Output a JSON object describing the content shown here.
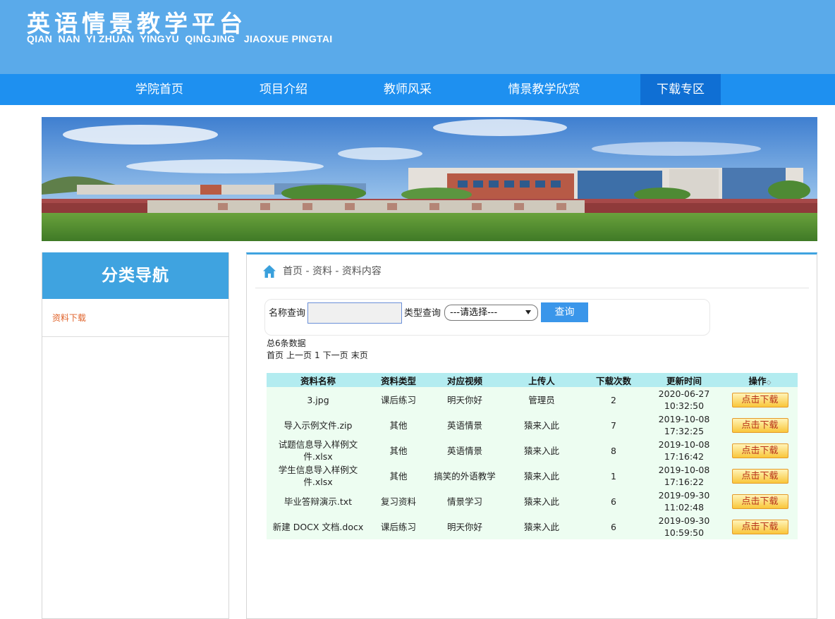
{
  "header": {
    "title": "英语情景教学平台",
    "subtitle": "QIAN  NAN  YI ZHUAN  YINGYU  QINGJING   JIAOXUE PINGTAI"
  },
  "nav": {
    "items": [
      {
        "label": "学院首页"
      },
      {
        "label": "项目介绍"
      },
      {
        "label": "教师风采"
      },
      {
        "label": "情景教学欣赏"
      },
      {
        "label": "下载专区"
      }
    ],
    "active_index": 4
  },
  "sidebar": {
    "heading": "分类导航",
    "links": [
      {
        "label": "资料下载"
      }
    ]
  },
  "breadcrumb": {
    "text": "首页 - 资料 - 资料内容"
  },
  "search": {
    "name_label": "名称查询",
    "name_value": "",
    "type_label": "类型查询",
    "type_selected": "---请选择---",
    "button_label": "查询"
  },
  "summary": {
    "total_text": "总6条数据",
    "pager": {
      "first": "首页",
      "prev": "上一页",
      "page": "1",
      "next": "下一页",
      "last": "末页"
    }
  },
  "table": {
    "columns": [
      "资料名称",
      "资料类型",
      "对应视频",
      "上传人",
      "下载次数",
      "更新时间",
      "操作"
    ],
    "rows": [
      {
        "name": "3.jpg",
        "type": "课后练习",
        "video": "明天你好",
        "uploader": "管理员",
        "downloads": "2",
        "date": "2020-06-27",
        "time": "10:32:50",
        "action": "点击下载"
      },
      {
        "name": "导入示例文件.zip",
        "type": "其他",
        "video": "英语情景",
        "uploader": "猿来入此",
        "downloads": "7",
        "date": "2019-10-08",
        "time": "17:32:25",
        "action": "点击下载"
      },
      {
        "name": "试题信息导入样例文件.xlsx",
        "type": "其他",
        "video": "英语情景",
        "uploader": "猿来入此",
        "downloads": "8",
        "date": "2019-10-08",
        "time": "17:16:42",
        "action": "点击下载"
      },
      {
        "name": "学生信息导入样例文件.xlsx",
        "type": "其他",
        "video": "搞笑的外语教学",
        "uploader": "猿来入此",
        "downloads": "1",
        "date": "2019-10-08",
        "time": "17:16:22",
        "action": "点击下载"
      },
      {
        "name": "毕业答辩演示.txt",
        "type": "复习资料",
        "video": "情景学习",
        "uploader": "猿来入此",
        "downloads": "6",
        "date": "2019-09-30",
        "time": "11:02:48",
        "action": "点击下载"
      },
      {
        "name": "新建 DOCX 文档.docx",
        "type": "课后练习",
        "video": "明天你好",
        "uploader": "猿来入此",
        "downloads": "6",
        "date": "2019-09-30",
        "time": "10:59:50",
        "action": "点击下载"
      }
    ]
  },
  "colors": {
    "header_bg": "#5aaaea",
    "nav_bg": "#1e90f0",
    "nav_active_bg": "#0f6fd4",
    "sidebar_head_bg": "#3fa3e0",
    "table_head_bg": "#b3ecf0",
    "table_row_bg": "#edfdf1",
    "link_color": "#e0642c"
  }
}
